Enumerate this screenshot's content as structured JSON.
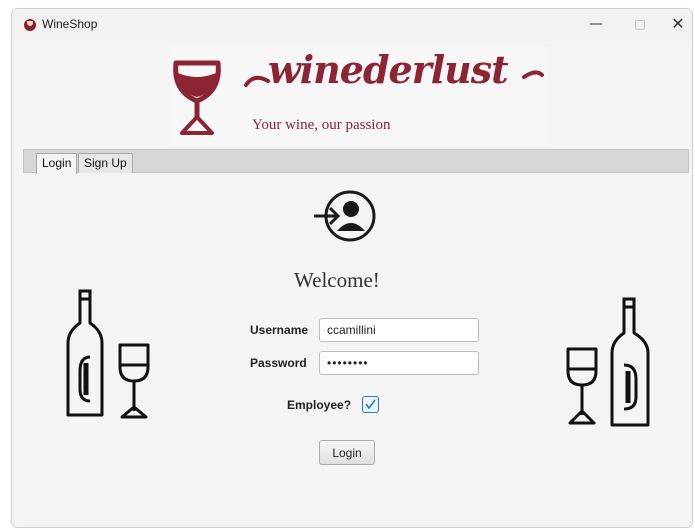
{
  "window": {
    "title": "WineShop",
    "minimize_glyph": "—",
    "maximize_glyph": "□",
    "close_glyph": "✕"
  },
  "logo": {
    "wordmark": "winederlust",
    "tagline": "Your wine, our passion"
  },
  "tabs": [
    {
      "label": "Login",
      "selected": true
    },
    {
      "label": "Sign Up",
      "selected": false
    }
  ],
  "login_form": {
    "heading": "Welcome!",
    "username_label": "Username",
    "username_value": "ccamillini",
    "password_label": "Password",
    "password_value": "••••••••",
    "employee_label": "Employee?",
    "employee_checked": true,
    "submit_label": "Login"
  },
  "icons": {
    "app": "wine-glass-icon",
    "login": "user-login-icon",
    "left_decoration": "wine-bottle-glass-icon",
    "right_decoration": "wine-glass-bottle-icon"
  },
  "colors": {
    "brand": "#8c2434",
    "checkbox_accent": "#2d7bbf"
  }
}
